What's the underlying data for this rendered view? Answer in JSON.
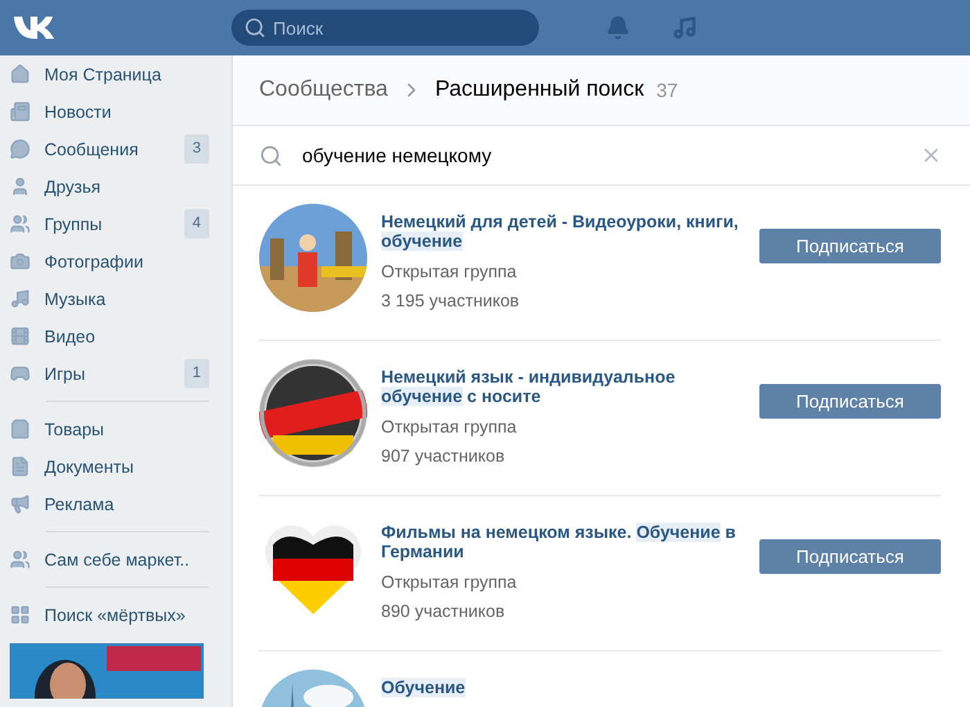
{
  "header": {
    "search": {
      "placeholder": "Поиск"
    }
  },
  "sidebar": {
    "sections": [
      [
        {
          "label": "Моя Страница"
        },
        {
          "label": "Новости"
        },
        {
          "label": "Сообщения",
          "badge": "3"
        },
        {
          "label": "Друзья"
        },
        {
          "label": "Группы",
          "badge": "4"
        },
        {
          "label": "Фотографии"
        },
        {
          "label": "Музыка"
        },
        {
          "label": "Видео"
        },
        {
          "label": "Игры",
          "badge": "1"
        }
      ],
      [
        {
          "label": "Товары"
        },
        {
          "label": "Документы"
        },
        {
          "label": "Реклама"
        }
      ],
      [
        {
          "label": "Сам себе маркет.."
        }
      ],
      [
        {
          "label": "Поиск «мёртвых»"
        }
      ]
    ],
    "ad": {
      "kind": "picture"
    }
  },
  "breadcrumb": {
    "parent": "Сообщества",
    "current": "Расширенный поиск",
    "count": "37"
  },
  "search": {
    "value": "обучение немецкому"
  },
  "results": [
    {
      "title": [
        {
          "text": "Немецкий для детей - Видеоуроки, книги, ",
          "highlight": false
        },
        {
          "text": "обучение",
          "highlight": true
        }
      ],
      "type": "Открытая группа",
      "members": "3 195 участников",
      "button": "Подписаться"
    },
    {
      "title": [
        {
          "text": "Немецкий язык - индивидуальное ",
          "highlight": false
        },
        {
          "text": "обучение",
          "highlight": true
        },
        {
          "text": " с носите",
          "highlight": false
        }
      ],
      "type": "Открытая группа",
      "members": "907 участников",
      "button": "Подписаться"
    },
    {
      "title": [
        {
          "text": "Фильмы на немецком языке. ",
          "highlight": false
        },
        {
          "text": "Обучение",
          "highlight": true
        },
        {
          "text": " в Германии",
          "highlight": false
        }
      ],
      "type": "Открытая группа",
      "members": "890 участников",
      "button": "Подписаться"
    },
    {
      "title": [
        {
          "text": "Обучение",
          "highlight": true
        }
      ]
    }
  ]
}
